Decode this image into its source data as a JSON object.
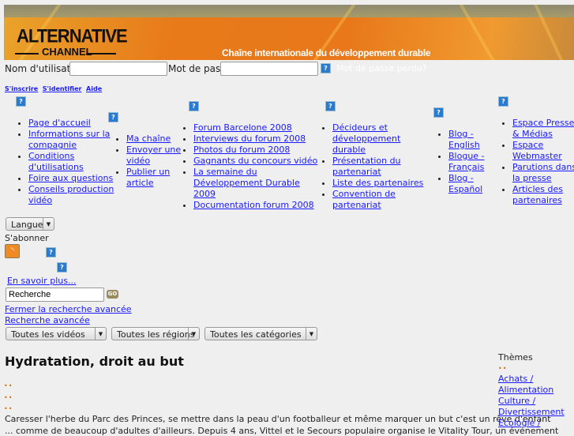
{
  "header": {
    "logo_line1": "ALTERNATIVE",
    "logo_line2": "CHANNEL",
    "tagline": "Chaîne internationale du développement durable"
  },
  "login": {
    "username_label": "Nom d'utilisateur",
    "password_label": "Mot de passe",
    "lost_password": "Mot de passe perdu?",
    "help": "?"
  },
  "account_links": [
    "S'inscrire",
    "S'identifier",
    "Aide"
  ],
  "nav": [
    {
      "items": [
        "Page d'accueil",
        "Informations sur la compagnie",
        "Conditions d'utilisations",
        "Foire aux questions",
        "Conseils production vidéo"
      ]
    },
    {
      "items": [
        "Ma chaîne",
        "Envoyer une vidéo",
        "Publier un article"
      ]
    },
    {
      "items": [
        "Forum Barcelone 2008",
        "Interviews du forum 2008",
        "Photos du forum 2008",
        "Gagnants du concours vidéo",
        "La semaine du Développement Durable 2009",
        "Documentation forum 2008"
      ]
    },
    {
      "items": [
        "Décideurs et développement durable",
        "Présentation du partenariat",
        "Liste des partenaires",
        "Convention de partenariat"
      ]
    },
    {
      "items": [
        "Blog - English",
        "Blogue - Français",
        "Blog - Español"
      ]
    },
    {
      "items": [
        "Espace Presse & Médias",
        "Espace Webmaster",
        "Parutions dans la presse",
        "Articles des partenaires"
      ]
    }
  ],
  "language_select": "Langue",
  "subscribe_label": "S'abonner",
  "learn_more": "En savoir plus...",
  "search": {
    "value": "Recherche",
    "go": "GO",
    "close_advanced": "Fermer la recherche avancée",
    "advanced": "Recherche avancée"
  },
  "filters": [
    "Toutes les vidéos",
    "Toutes les régions",
    "Toutes les catégories"
  ],
  "article": {
    "title": "Hydratation, droit au but",
    "body_line1": "Caresser l'herbe du Parc des Princes, se mettre dans la peau d'un footballeur et même marquer un but c'est un rêve d'enfant",
    "body_line2": "... comme de beaucoup d'adultes d'ailleurs. Depuis 4 ans, Vittel et le Secours populaire organise le Vitality Tour, un événement"
  },
  "sidebar": {
    "title": "Thèmes",
    "themes": [
      "Achats / Alimentation",
      "Culture / Divertissement",
      "Ecologie /"
    ]
  },
  "colors": {
    "banner": "#e8781a",
    "link": "#1a1aff",
    "help_icon": "#2a7ad0",
    "rss": "#f08a24"
  }
}
